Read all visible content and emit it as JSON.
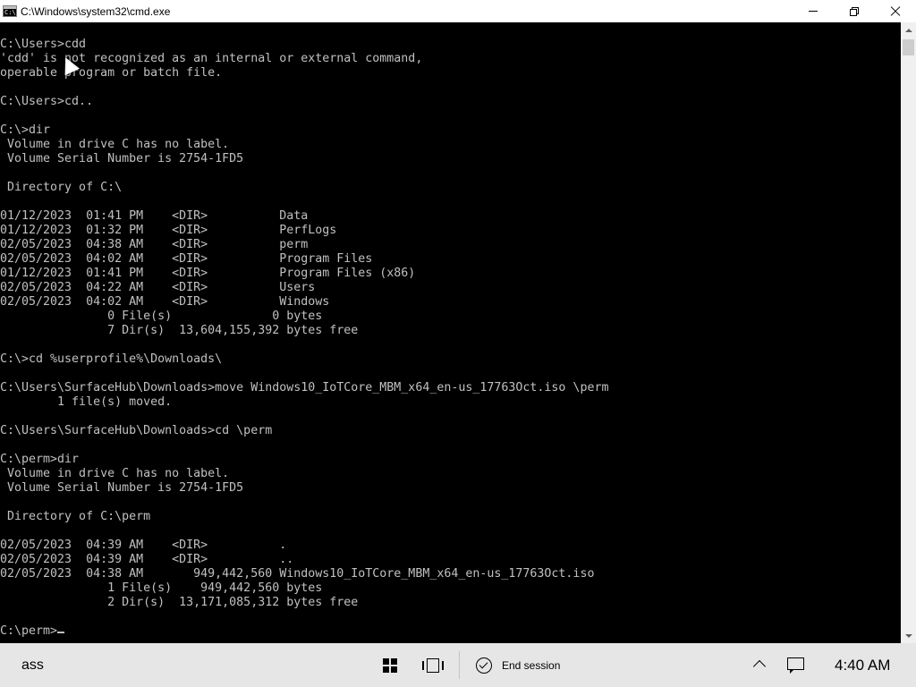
{
  "window": {
    "title": "C:\\Windows\\system32\\cmd.exe",
    "icon_text": "C:\\"
  },
  "console": {
    "lines": [
      "C:\\Users>cdd",
      "'cdd' is not recognized as an internal or external command,",
      "operable program or batch file.",
      "",
      "C:\\Users>cd..",
      "",
      "C:\\>dir",
      " Volume in drive C has no label.",
      " Volume Serial Number is 2754-1FD5",
      "",
      " Directory of C:\\",
      "",
      "01/12/2023  01:41 PM    <DIR>          Data",
      "01/12/2023  01:32 PM    <DIR>          PerfLogs",
      "02/05/2023  04:38 AM    <DIR>          perm",
      "02/05/2023  04:02 AM    <DIR>          Program Files",
      "01/12/2023  01:41 PM    <DIR>          Program Files (x86)",
      "02/05/2023  04:22 AM    <DIR>          Users",
      "02/05/2023  04:02 AM    <DIR>          Windows",
      "               0 File(s)              0 bytes",
      "               7 Dir(s)  13,604,155,392 bytes free",
      "",
      "C:\\>cd %userprofile%\\Downloads\\",
      "",
      "C:\\Users\\SurfaceHub\\Downloads>move Windows10_IoTCore_MBM_x64_en-us_17763Oct.iso \\perm",
      "        1 file(s) moved.",
      "",
      "C:\\Users\\SurfaceHub\\Downloads>cd \\perm",
      "",
      "C:\\perm>dir",
      " Volume in drive C has no label.",
      " Volume Serial Number is 2754-1FD5",
      "",
      " Directory of C:\\perm",
      "",
      "02/05/2023  04:39 AM    <DIR>          .",
      "02/05/2023  04:39 AM    <DIR>          ..",
      "02/05/2023  04:38 AM       949,442,560 Windows10_IoTCore_MBM_x64_en-us_17763Oct.iso",
      "               1 File(s)    949,442,560 bytes",
      "               2 Dir(s)  13,171,085,312 bytes free",
      "",
      "C:\\perm>"
    ]
  },
  "taskbar": {
    "user_label": "ass",
    "end_session_label": "End session",
    "clock": "4:40 AM"
  },
  "colors": {
    "console_bg": "#000000",
    "console_text": "#c0c0c0",
    "taskbar_bg": "#e6e6e6"
  },
  "icons": {
    "titlebar": [
      "cmd-icon",
      "minimize-icon",
      "restore-icon",
      "close-icon"
    ],
    "taskbar": [
      "windows-start-icon",
      "task-view-icon",
      "end-session-icon",
      "chevron-up-icon",
      "action-center-icon"
    ]
  }
}
